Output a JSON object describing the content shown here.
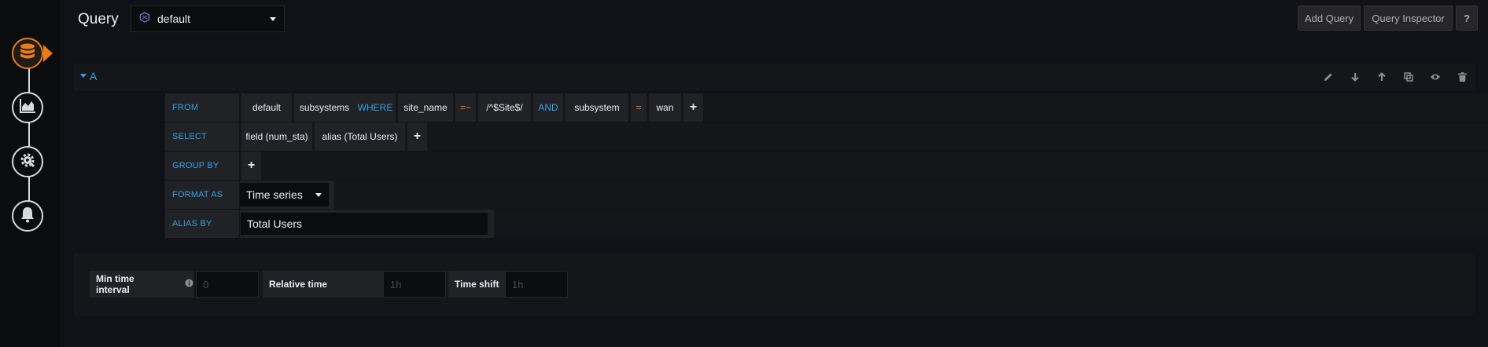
{
  "header": {
    "title": "Query",
    "datasource": "default",
    "buttons": {
      "add_query": "Add Query",
      "query_inspector": "Query Inspector",
      "help": "?"
    }
  },
  "sidebar": {
    "items": [
      {
        "name": "queries",
        "icon": "database-icon",
        "active": true
      },
      {
        "name": "visualization",
        "icon": "area-chart-icon",
        "active": false
      },
      {
        "name": "general",
        "icon": "gear-icon",
        "active": false
      },
      {
        "name": "alert",
        "icon": "bell-icon",
        "active": false
      }
    ]
  },
  "query": {
    "ref_id": "A",
    "actions": [
      "edit-icon",
      "move-down-icon",
      "move-up-icon",
      "duplicate-icon",
      "toggle-visibility-icon",
      "delete-icon"
    ],
    "from": {
      "keyword": "FROM",
      "policy": "default",
      "measurement": "subsystems",
      "where_keyword": "WHERE",
      "tag1_key": "site_name",
      "tag1_op": "=~",
      "tag1_value": "/^$Site$/",
      "and_keyword": "AND",
      "tag2_key": "subsystem",
      "tag2_op": "=",
      "tag2_value": "wan",
      "add": "+"
    },
    "select": {
      "keyword": "SELECT",
      "field": "field (num_sta)",
      "alias": "alias (Total Users)",
      "add": "+"
    },
    "group_by": {
      "keyword": "GROUP BY",
      "add": "+"
    },
    "format_as": {
      "keyword": "FORMAT AS",
      "value": "Time series"
    },
    "alias_by": {
      "keyword": "ALIAS BY",
      "value": "Total Users"
    }
  },
  "options": {
    "min_interval": {
      "label": "Min time interval",
      "placeholder": "0"
    },
    "relative_time": {
      "label": "Relative time",
      "placeholder": "1h"
    },
    "time_shift": {
      "label": "Time shift",
      "placeholder": "1h"
    }
  },
  "colors": {
    "accent": "#eb7b18",
    "keyword": "#33a2e5"
  }
}
